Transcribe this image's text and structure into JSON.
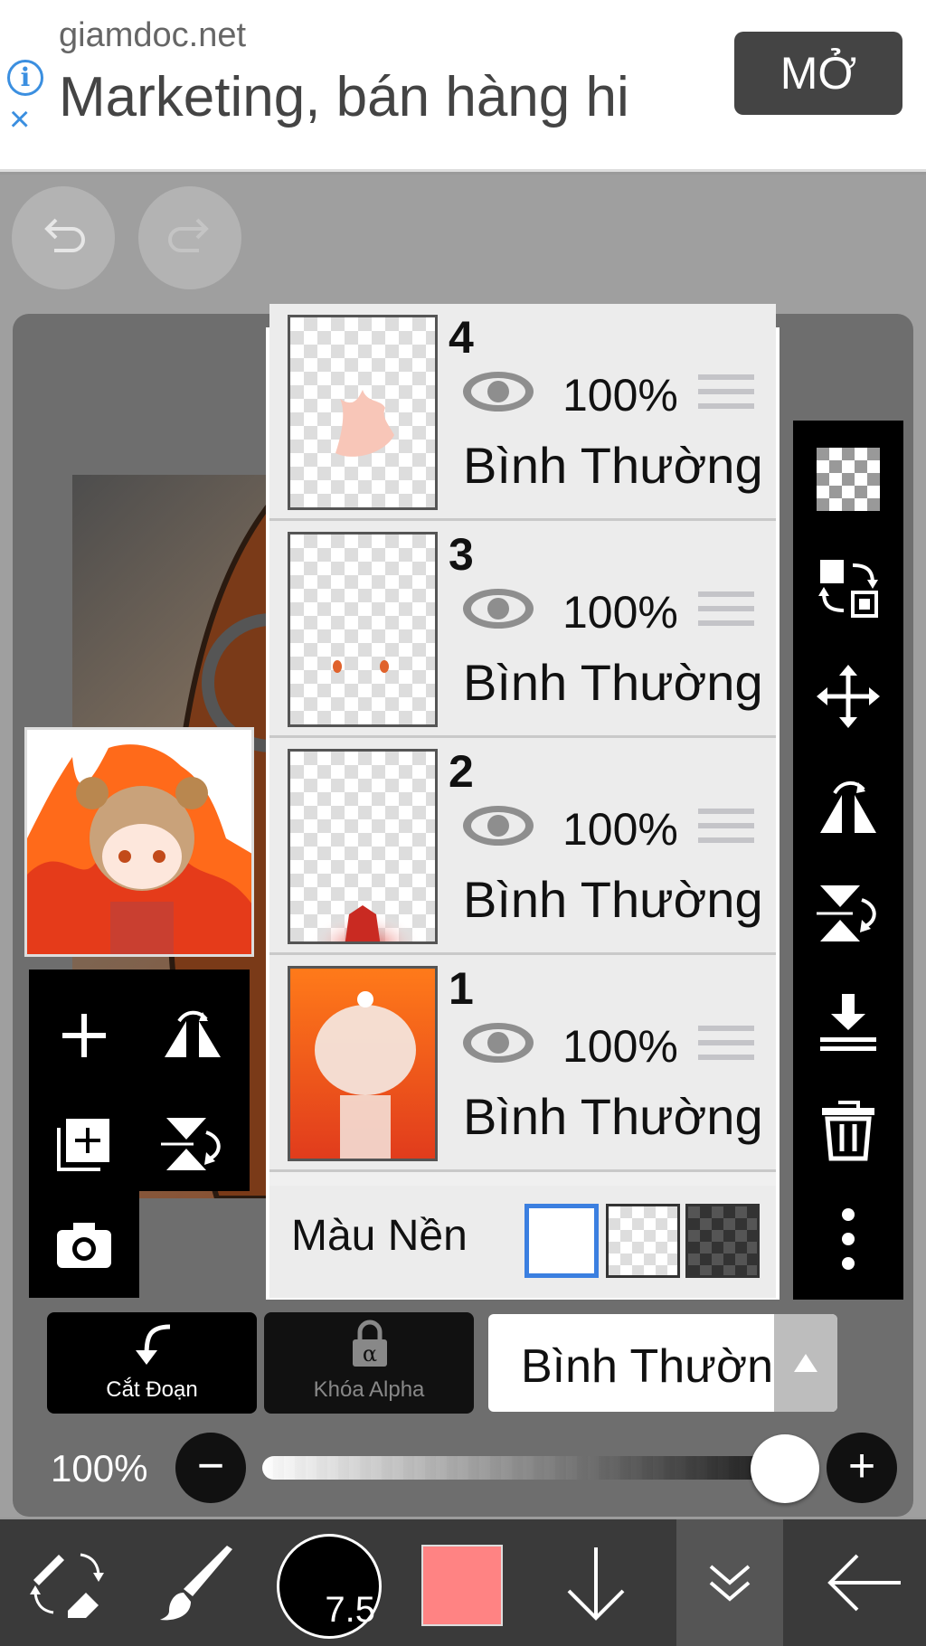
{
  "ad": {
    "source": "giamdoc.net",
    "text": "Marketing, bán hàng hi",
    "open_label": "MỞ",
    "info_icon": "i",
    "close_icon": "×"
  },
  "layers": [
    {
      "number": "4",
      "opacity": "100%",
      "blend": "Bình Thường"
    },
    {
      "number": "3",
      "opacity": "100%",
      "blend": "Bình Thường"
    },
    {
      "number": "2",
      "opacity": "100%",
      "blend": "Bình Thường"
    },
    {
      "number": "1",
      "opacity": "100%",
      "blend": "Bình Thường"
    }
  ],
  "background": {
    "label": "Màu Nền"
  },
  "controls": {
    "clipping_label": "Cắt Đoạn",
    "alpha_lock_label": "Khóa Alpha",
    "blend_mode": "Bình Thường",
    "opacity_label": "100%",
    "minus": "−",
    "plus": "+"
  },
  "opacity_slider": {
    "value": 1.0
  },
  "toolbar": {
    "brush_size": "7.5",
    "color": "#ff8383"
  }
}
